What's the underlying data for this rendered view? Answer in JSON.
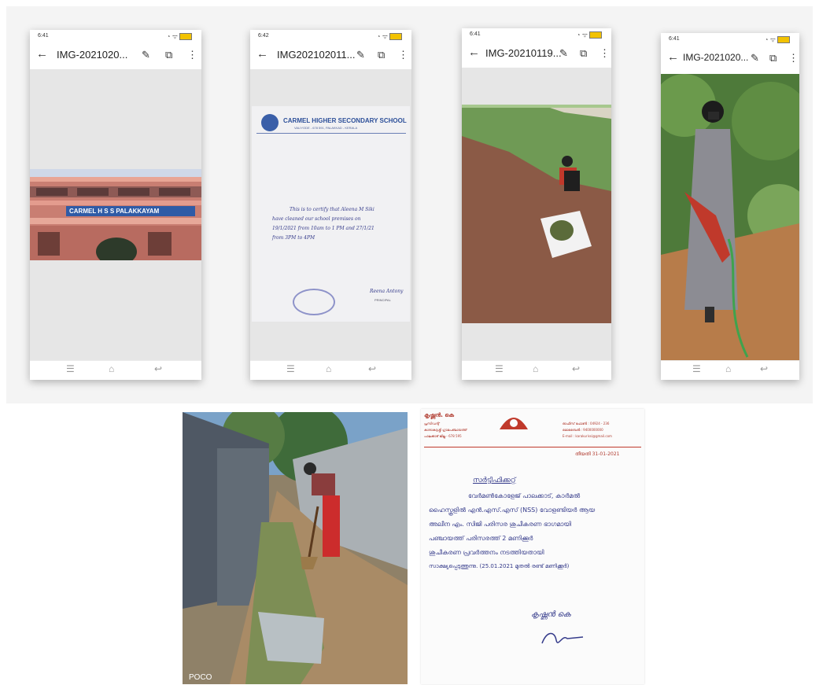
{
  "phones": [
    {
      "time": "6:41",
      "title": "IMG-2021020...",
      "building_sign": "CARMEL H S S PALAKKAYAM"
    },
    {
      "time": "6:42",
      "title": "IMG202102011...",
      "letterhead": {
        "school": "CARMEL HIGHER SECONDARY SCHOOL",
        "address": "VALIYODE - 678 591, PALAKKAD - KERALA"
      },
      "letter_lines": [
        "This is to certify that Aleena M Siki",
        "have cleaned our school premises on",
        "19/1/2021 from 10am to 1 PM and 27/1/21",
        "from 3PM to 4PM"
      ],
      "sign": "Reena Antony",
      "sign_role": "PRINCIPAL"
    },
    {
      "time": "6:41",
      "title": "IMG-20210119..."
    },
    {
      "time": "6:41",
      "title": "IMG-2021020..."
    }
  ],
  "photo_label": "POCO",
  "certificate": {
    "header_left": [
      "കൃഷ്ണൻ. കെ",
      "പ്രസിഡന്റ്",
      "കാരാകുറുശ്ശി ഗ്രാമപഞ്ചായത്ത്",
      "പാലക്കാട് ജില്ല - 678 595"
    ],
    "header_right": [
      "ഓഫീസ് ഫോൺ : 04924 - 236",
      "മൊബൈൽ : 9400000000",
      "E-mail : karakurissi@gmail.com"
    ],
    "date": "തീയതി 31-01-2021",
    "heading": "സർട്ടിഫിക്കറ്റ്",
    "lines": [
      "വേർമൺകോളേജ് പാലക്കാട്, കാർമൽ",
      "ഹൈസ്കൂളിൽ എൻ.എസ്.എസ് (NSS) വോളണ്ടിയർ ആയ",
      "അലീന എം. സിജി പരിസര ശുചീകരണ ഭാഗമായി",
      "പഞ്ചായത്ത് പരിസരത്ത് 2 മണിക്കൂർ",
      "ശുചീകരണ പ്രവർത്തനം നടത്തിയതായി",
      "സാക്ഷ്യപ്പെടുത്തുന്നു. (25.01.2021 മുതൽ രണ്ട് മണിക്കൂർ)"
    ],
    "sign": "കൃഷ്ണൻ കെ"
  }
}
